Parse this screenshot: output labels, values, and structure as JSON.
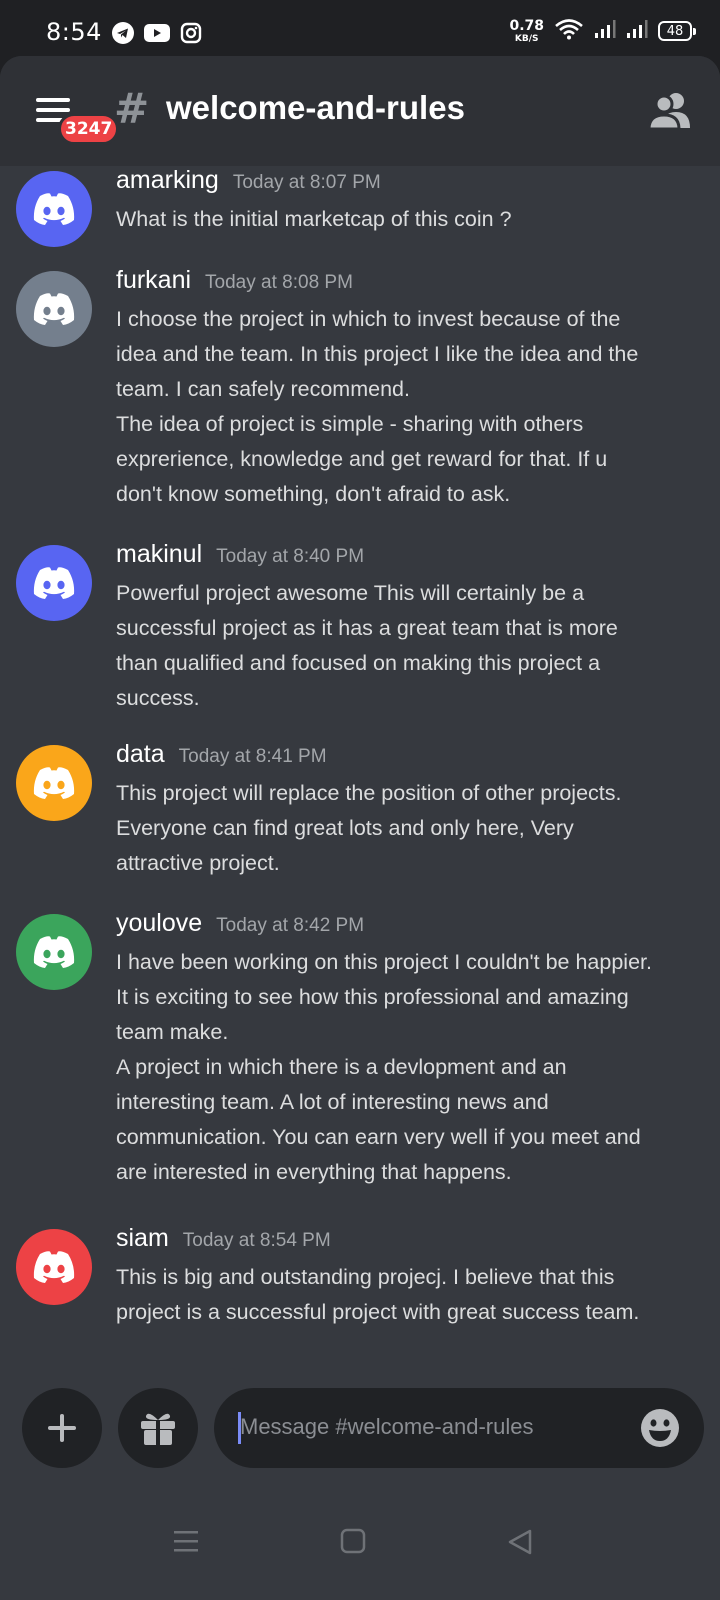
{
  "status_bar": {
    "time": "8:54",
    "net_speed_value": "0.78",
    "net_speed_unit": "KB/S",
    "battery": "48",
    "app_icons": [
      "telegram-icon",
      "youtube-icon",
      "instagram-icon"
    ]
  },
  "header": {
    "badge": "3247",
    "channel_name": "welcome-and-rules"
  },
  "messages": [
    {
      "username": "amarking",
      "timestamp": "Today at 8:07 PM",
      "avatar_color": "#5865f2",
      "lines": [
        "What is the initial marketcap of this coin ?"
      ]
    },
    {
      "username": "furkani",
      "timestamp": "Today at 8:08 PM",
      "avatar_color": "#747f8d",
      "lines": [
        "I choose the project in which to invest because of the",
        "idea and the team. In this project I like the idea and the",
        "team. I can safely recommend.",
        "The idea of project is simple - sharing with others",
        "exprerience, knowledge and get reward for that. If u",
        "don't know something, don't afraid to ask."
      ]
    },
    {
      "username": "makinul",
      "timestamp": "Today at 8:40 PM",
      "avatar_color": "#5865f2",
      "lines": [
        "Powerful project awesome This will certainly be a",
        "successful project as it has a great team that is more",
        "than qualified and focused on making this project a",
        "success."
      ]
    },
    {
      "username": "data",
      "timestamp": "Today at 8:41 PM",
      "avatar_color": "#faa61a",
      "lines": [
        "This project will replace the position of other projects.",
        "Everyone can find great lots and only here, Very",
        "attractive project."
      ]
    },
    {
      "username": "youlove",
      "timestamp": "Today at 8:42 PM",
      "avatar_color": "#3ba55c",
      "lines": [
        "I have been working on this project I couldn't be happier.",
        "It is exciting to see how this professional and amazing",
        "team make.",
        "A project in which there is a devlopment and an",
        "interesting team. A lot of interesting news and",
        "communication. You can earn very well if you meet and",
        "are interested in everything that happens."
      ]
    },
    {
      "username": "siam",
      "timestamp": "Today at 8:54 PM",
      "avatar_color": "#ed4245",
      "lines": [
        "This is big and outstanding projecj. I believe that this",
        "project is a successful project with great success team."
      ]
    }
  ],
  "composer": {
    "placeholder": "Message #welcome-and-rules"
  }
}
